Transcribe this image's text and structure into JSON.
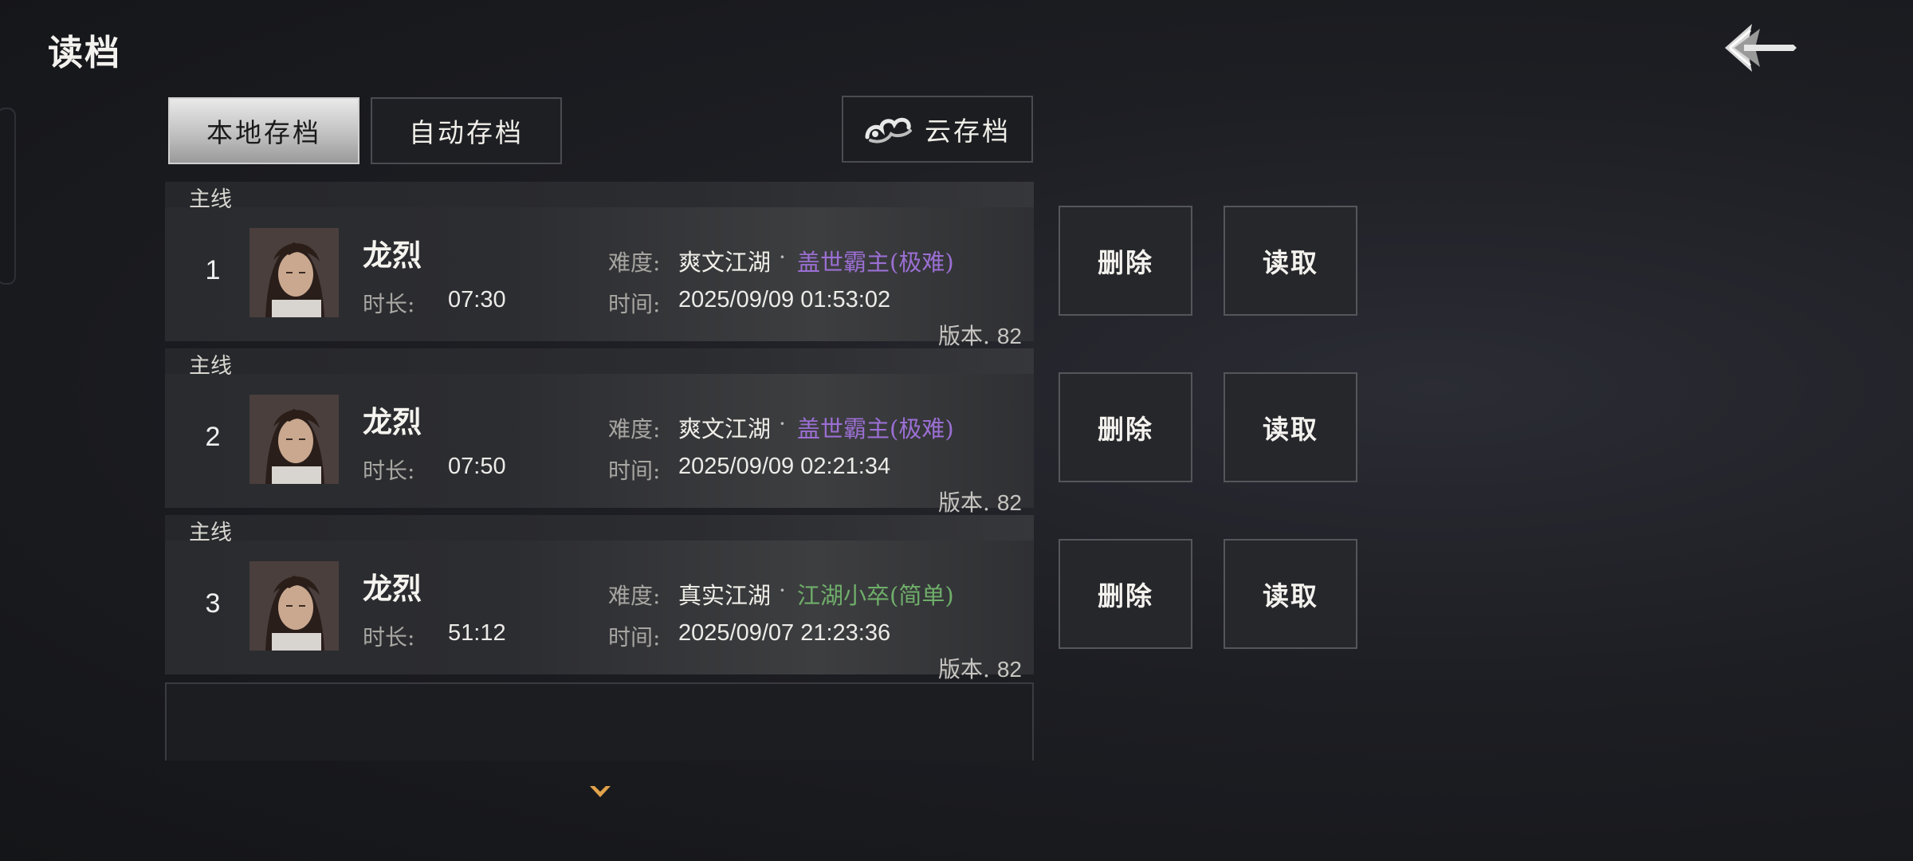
{
  "header": {
    "title": "读档",
    "back_icon": "back-arrow-icon"
  },
  "tabs": {
    "local_label": "本地存档",
    "auto_label": "自动存档",
    "cloud_label": "云存档",
    "cloud_icon": "cloud-icon",
    "active": "local"
  },
  "saves": [
    {
      "tag": "主线",
      "index": "1",
      "name": "龙烈",
      "difficulty_label": "难度:",
      "mode": "爽文江湖",
      "dot": "·",
      "level": "盖世霸主(极难)",
      "level_color": "#9b6fd3",
      "duration_label": "时长:",
      "duration": "07:30",
      "time_label": "时间:",
      "time": "2025/09/09 01:53:02",
      "version_label": "版本.",
      "version": "82",
      "delete_label": "删除",
      "load_label": "读取"
    },
    {
      "tag": "主线",
      "index": "2",
      "name": "龙烈",
      "difficulty_label": "难度:",
      "mode": "爽文江湖",
      "dot": "·",
      "level": "盖世霸主(极难)",
      "level_color": "#9b6fd3",
      "duration_label": "时长:",
      "duration": "07:50",
      "time_label": "时间:",
      "time": "2025/09/09 02:21:34",
      "version_label": "版本.",
      "version": "82",
      "delete_label": "删除",
      "load_label": "读取"
    },
    {
      "tag": "主线",
      "index": "3",
      "name": "龙烈",
      "difficulty_label": "难度:",
      "mode": "真实江湖",
      "dot": "·",
      "level": "江湖小卒(简单)",
      "level_color": "#6fae6a",
      "duration_label": "时长:",
      "duration": "51:12",
      "time_label": "时间:",
      "time": "2025/09/07 21:23:36",
      "version_label": "版本.",
      "version": "82",
      "delete_label": "删除",
      "load_label": "读取"
    }
  ],
  "scroll_icon": "chevron-down-icon",
  "colors": {
    "accent_purple": "#9b6fd3",
    "accent_green": "#6fae6a",
    "scroll_gold": "#e0a24a"
  }
}
